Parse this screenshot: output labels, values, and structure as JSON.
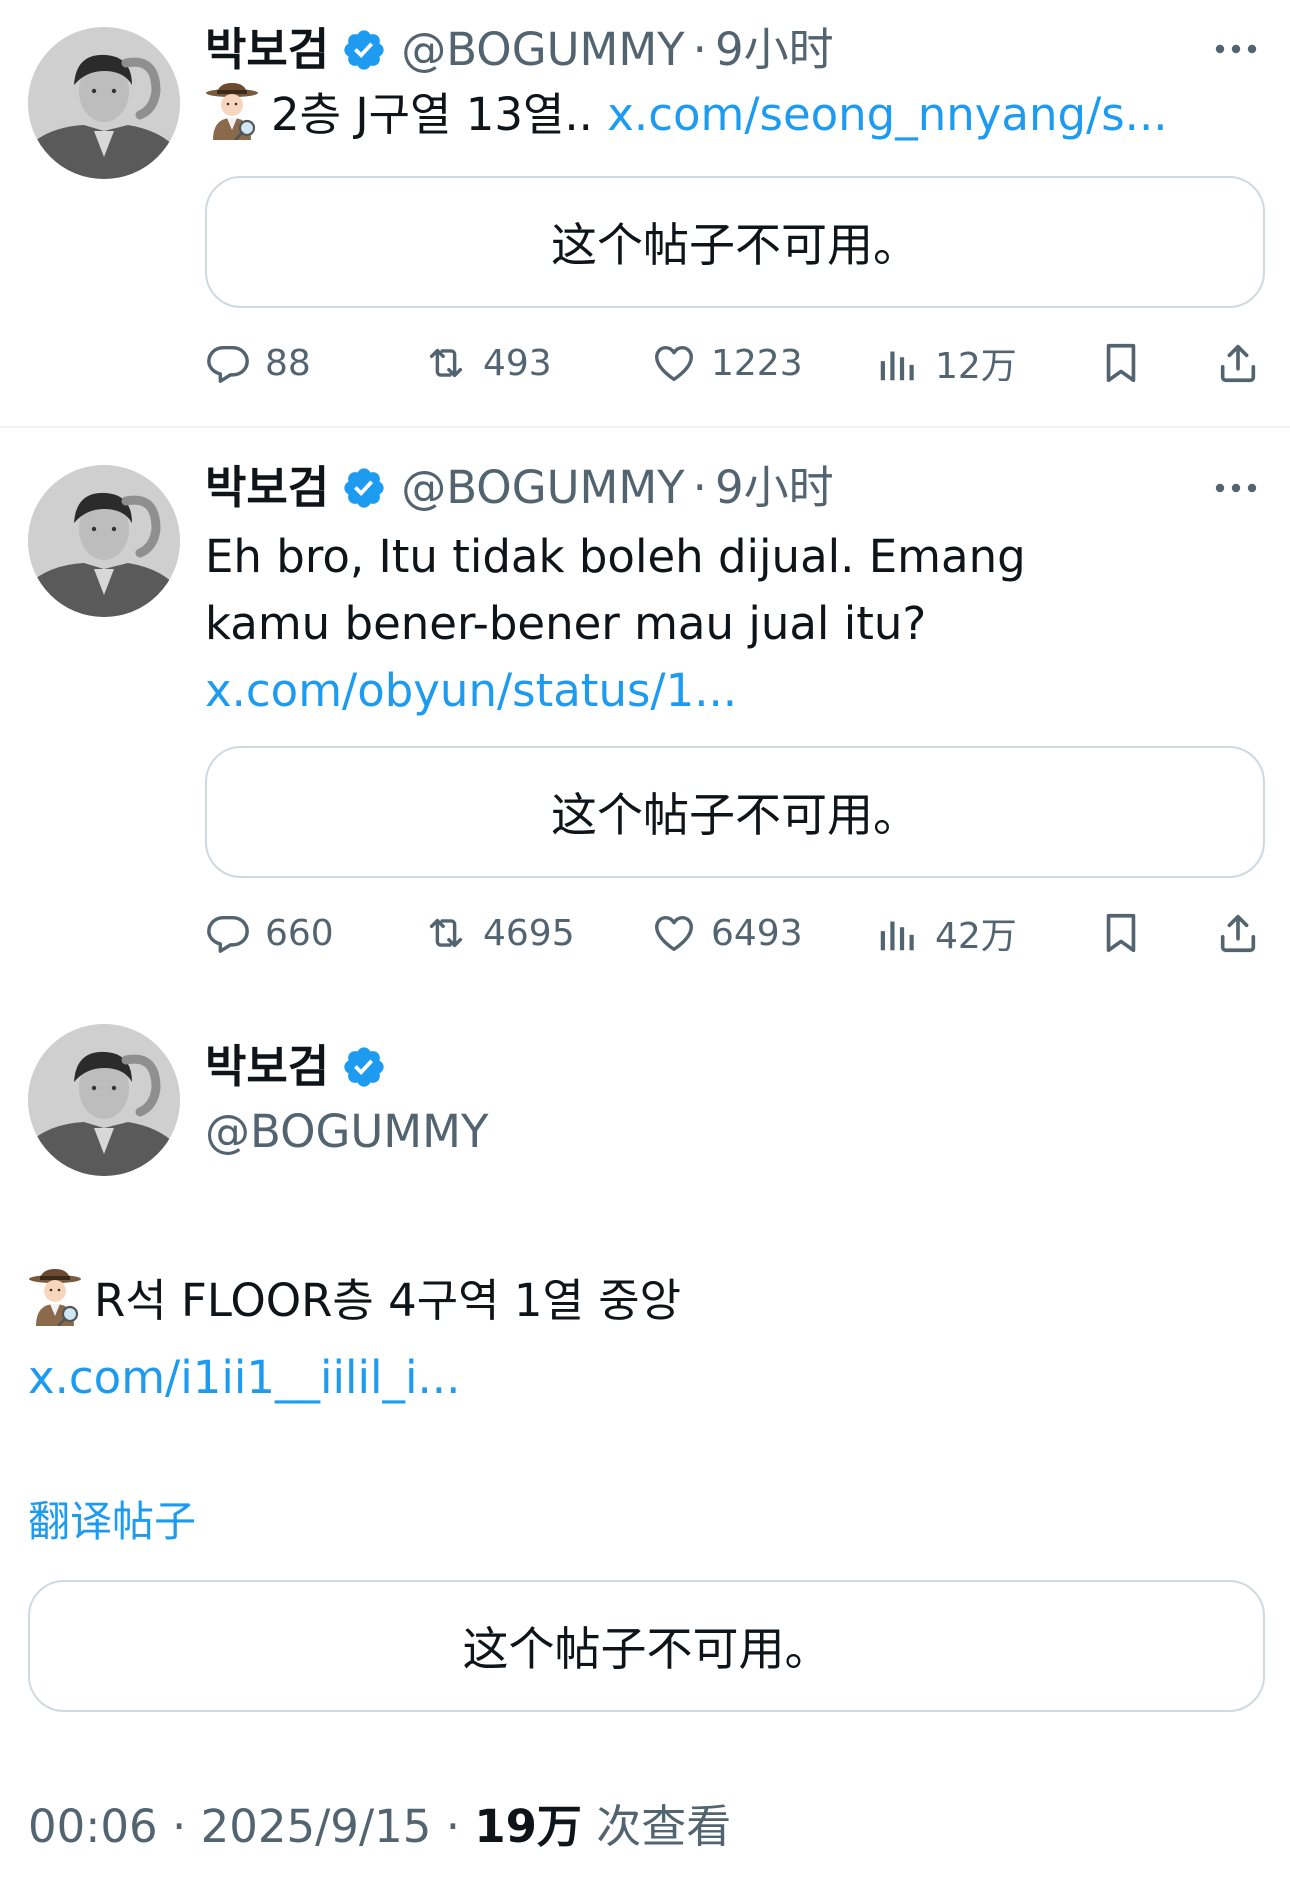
{
  "tweets": [
    {
      "name": "박보검",
      "handle": "@BOGUMMY",
      "dot": "·",
      "time": "9小时",
      "text": "2층 J구열 13열.. ",
      "link": "x.com/seong_nnyang/s...",
      "quote": "这个帖子不可用。",
      "replies": "88",
      "reposts": "493",
      "likes": "1223",
      "views": "12万"
    },
    {
      "name": "박보검",
      "handle": "@BOGUMMY",
      "dot": "·",
      "time": "9小时",
      "text": "Eh bro, Itu tidak boleh dijual. Emang kamu bener-bener mau jual itu? ",
      "link": "x.com/obyun/status/1...",
      "quote": "这个帖子不可用。",
      "replies": "660",
      "reposts": "4695",
      "likes": "6493",
      "views": "42万"
    }
  ],
  "main": {
    "name": "박보검",
    "handle": "@BOGUMMY",
    "text": "R석 FLOOR층 4구역 1열 중앙 ",
    "link": "x.com/i1ii1__iilil_i...",
    "translate": "翻译帖子",
    "quote": "这个帖子不可用。",
    "time": "00:06",
    "sep": "·",
    "date": "2025/9/15",
    "views_count": "19万",
    "views_label": "次查看"
  },
  "colors": {
    "accent": "#1d9bf0",
    "muted": "#536471",
    "border": "#cfd9de"
  },
  "icons": [
    "reply-icon",
    "repost-icon",
    "like-icon",
    "views-icon",
    "bookmark-icon",
    "share-icon",
    "more-icon",
    "verified-icon",
    "detective-emoji"
  ]
}
